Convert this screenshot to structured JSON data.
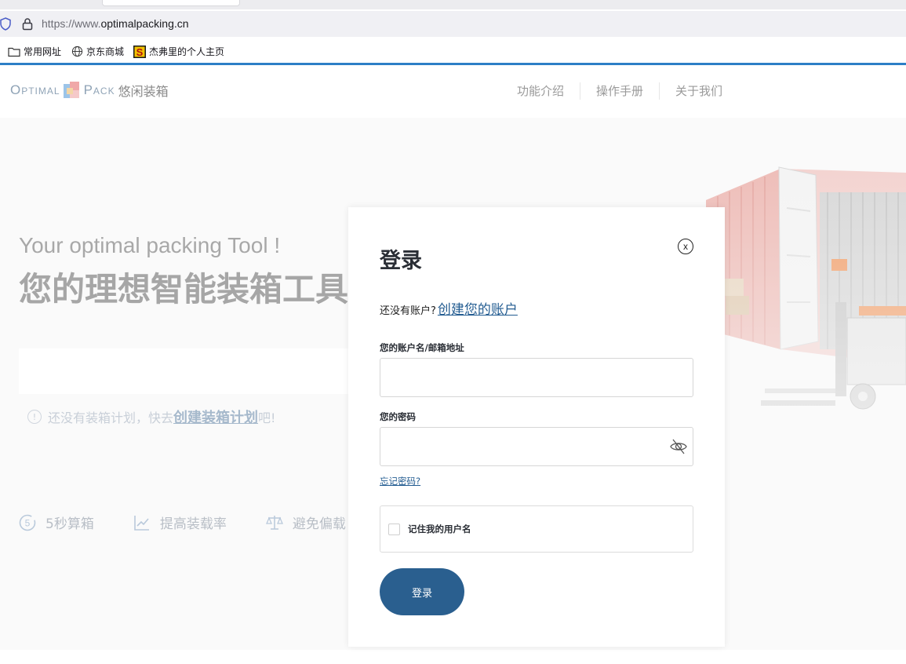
{
  "browser": {
    "url_protocol": "https://www.",
    "url_host": "optimalpacking.cn",
    "bookmarks": [
      {
        "label": "常用网址",
        "icon": "folder-icon"
      },
      {
        "label": "京东商城",
        "icon": "globe-icon"
      },
      {
        "label": "杰弗里的个人主页",
        "icon": "site-favicon-icon"
      }
    ],
    "accent_color": "#2d7fc6"
  },
  "header": {
    "logo_left": "Optimal",
    "logo_right": "Pack",
    "logo_cn": "悠闲装箱",
    "nav": [
      "功能介绍",
      "操作手册",
      "关于我们"
    ]
  },
  "hero": {
    "tagline_en": "Your optimal packing Tool !",
    "tagline_cn": "您的理想智能装箱工具",
    "tip_prefix": "还没有装箱计划，快去",
    "tip_link": "创建装箱计划",
    "tip_suffix": "吧!",
    "features": [
      {
        "label": "5秒算箱",
        "icon": "five-seconds-icon"
      },
      {
        "label": "提高装载率",
        "icon": "chart-line-icon"
      },
      {
        "label": "避免偏载",
        "icon": "balance-scale-icon"
      }
    ]
  },
  "login": {
    "title": "登录",
    "close_label": "x",
    "no_account_text": "还没有账户?",
    "create_account_link": "创建您的账户",
    "username_label": "您的账户名/邮箱地址",
    "username_value": "",
    "password_label": "您的密码",
    "password_value": "",
    "forgot_password": "忘记密码?",
    "remember_label": "记住我的用户名",
    "remember_checked": false,
    "submit_label": "登录",
    "button_color": "#2a5f8f"
  }
}
